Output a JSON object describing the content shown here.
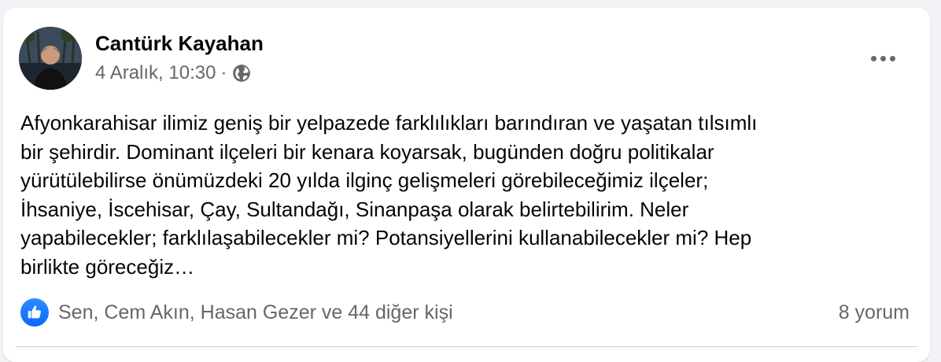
{
  "post": {
    "author": "Cantürk Kayahan",
    "date": "4 Aralık, 10:30",
    "separator": "·",
    "privacy_icon": "globe-icon",
    "more_icon": "more-horizontal-icon",
    "text": "Afyonkarahisar ilimiz geniş bir yelpazede farklılıkları barındıran ve yaşatan tılsımlı\nbir şehirdir. Dominant ilçeleri bir kenara koyarsak, bugünden doğru politikalar\nyürütülebilirse önümüzdeki 20 yılda ilginç gelişmeleri görebileceğimiz ilçeler;\nİhsaniye, İscehisar, Çay, Sultandağı, Sinanpaşa olarak belirtebilirim. Neler\nyapabilecekler; farklılaşabilecekler mi? Potansiyellerini kullanabilecekler mi? Hep\nbirlikte göreceğiz…"
  },
  "reactions": {
    "icon": "like-icon",
    "summary": "Sen, Cem Akın, Hasan Gezer ve 44 diğer kişi"
  },
  "comments": {
    "label": "8 yorum"
  },
  "colors": {
    "accent": "#0866ff",
    "text_primary": "#050505",
    "text_secondary": "#65676b",
    "background": "#f0f2f5",
    "card": "#ffffff"
  }
}
